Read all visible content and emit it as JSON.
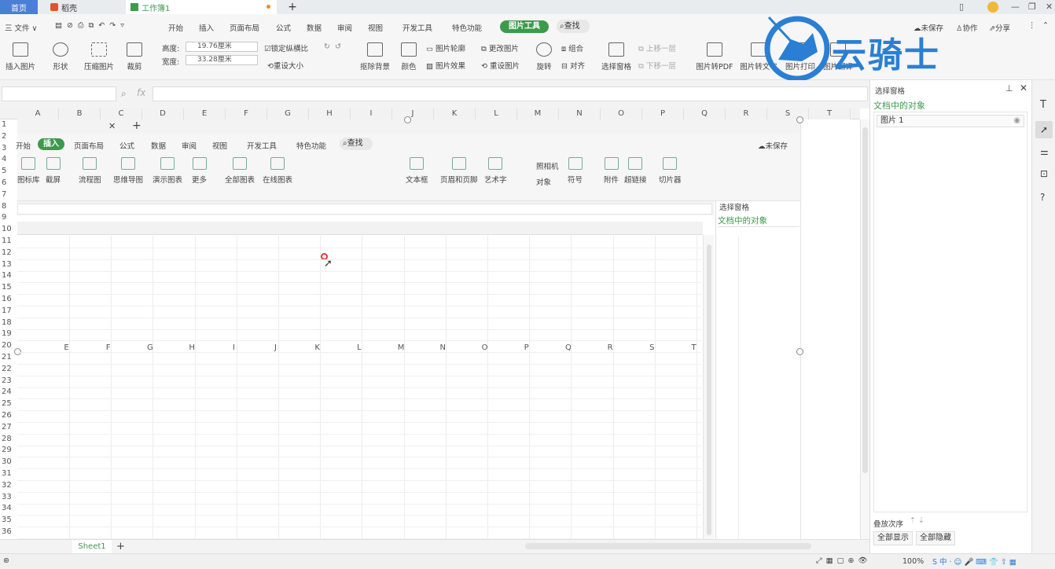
{
  "titlebar": {
    "tabs": [
      {
        "label": "首页",
        "active": true
      },
      {
        "label": "稻壳",
        "active": false
      },
      {
        "label": "工作簿1",
        "active": false
      }
    ],
    "new_tab": "+"
  },
  "menubar": {
    "file": "三 文件 ∨",
    "items": [
      "开始",
      "插入",
      "页面布局",
      "公式",
      "数据",
      "审阅",
      "视图",
      "开发工具",
      "特色功能"
    ],
    "active_pill": "图片工具",
    "search": "查找",
    "right": {
      "unsaved": "未保存",
      "collab": "协作",
      "share": "分享"
    }
  },
  "ribbon": {
    "insert_picture": "插入图片",
    "shape": "形状",
    "compress": "压缩图片",
    "crop": "裁剪",
    "height_label": "高度:",
    "height_value": "19.76厘米",
    "width_label": "宽度:",
    "width_value": "33.28厘米",
    "lock_ratio": "锁定纵横比",
    "reset_size": "重设大小",
    "remove_bg": "抠除背景",
    "color": "颜色",
    "outline": "图片轮廓",
    "effect": "图片效果",
    "change": "更改图片",
    "reset": "重设图片",
    "rotate": "旋转",
    "group": "组合",
    "align": "对齐",
    "select_pane": "选择窗格",
    "up": "上移一层",
    "down": "下移一层",
    "to_pdf": "图片转PDF",
    "to_text": "图片转文字",
    "print": "图片打印",
    "flip": "图片翻译"
  },
  "watermark": "云骑士",
  "columns": [
    "A",
    "B",
    "C",
    "D",
    "E",
    "F",
    "G",
    "H",
    "I",
    "J",
    "K",
    "L",
    "M",
    "N",
    "O",
    "P",
    "Q",
    "R",
    "S",
    "T"
  ],
  "rows": [
    "1",
    "2",
    "3",
    "4",
    "5",
    "6",
    "7",
    "8",
    "9",
    "10",
    "11",
    "12",
    "13",
    "14",
    "15",
    "16",
    "17",
    "18",
    "19",
    "20",
    "21",
    "22",
    "23",
    "24",
    "25",
    "26",
    "27",
    "28",
    "29",
    "30",
    "31",
    "32",
    "33",
    "34",
    "35",
    "36"
  ],
  "inner": {
    "menu": [
      "开始",
      "插入",
      "页面布局",
      "公式",
      "数据",
      "审阅",
      "视图",
      "开发工具",
      "特色功能"
    ],
    "search": "查找",
    "unsaved": "未保存",
    "tools": [
      "图标库",
      "截屏",
      "流程图",
      "思维导图",
      "演示图表",
      "更多",
      "全部图表",
      "在线图表",
      "文本框",
      "页眉和页脚",
      "艺术字",
      "符号",
      "附件",
      "超链接",
      "切片器"
    ],
    "camera": "照相机",
    "object": "对象",
    "columns": [
      "E",
      "F",
      "G",
      "H",
      "I",
      "J",
      "K",
      "L",
      "M",
      "N",
      "O",
      "P",
      "Q",
      "R",
      "S",
      "T"
    ],
    "pane_title": "选择窗格",
    "pane_sub": "文档中的对象"
  },
  "pane": {
    "title": "选择窗格",
    "subtitle": "文档中的对象",
    "item": "图片 1",
    "order": "叠放次序",
    "show_all": "全部显示",
    "hide_all": "全部隐藏"
  },
  "sheet": {
    "tab": "Sheet1",
    "add": "+"
  },
  "status": {
    "zoom": "100%"
  },
  "colors": {
    "accent": "#3c9a4c",
    "watermark": "#2a7fd4"
  }
}
